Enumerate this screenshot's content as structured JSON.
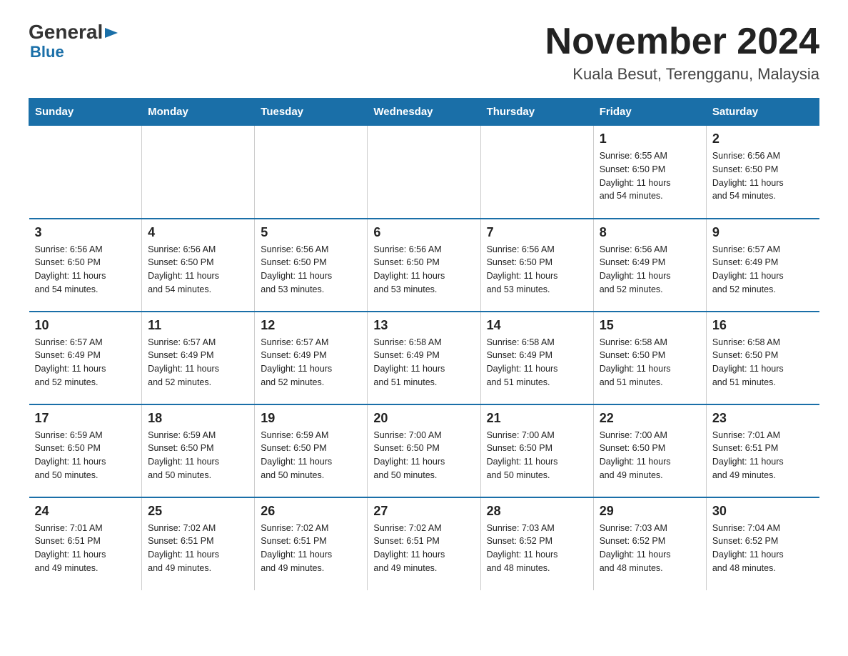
{
  "logo": {
    "general": "General",
    "blue": "Blue"
  },
  "title": {
    "month": "November 2024",
    "location": "Kuala Besut, Terengganu, Malaysia"
  },
  "weekdays": [
    "Sunday",
    "Monday",
    "Tuesday",
    "Wednesday",
    "Thursday",
    "Friday",
    "Saturday"
  ],
  "weeks": [
    [
      {
        "day": "",
        "info": ""
      },
      {
        "day": "",
        "info": ""
      },
      {
        "day": "",
        "info": ""
      },
      {
        "day": "",
        "info": ""
      },
      {
        "day": "",
        "info": ""
      },
      {
        "day": "1",
        "info": "Sunrise: 6:55 AM\nSunset: 6:50 PM\nDaylight: 11 hours\nand 54 minutes."
      },
      {
        "day": "2",
        "info": "Sunrise: 6:56 AM\nSunset: 6:50 PM\nDaylight: 11 hours\nand 54 minutes."
      }
    ],
    [
      {
        "day": "3",
        "info": "Sunrise: 6:56 AM\nSunset: 6:50 PM\nDaylight: 11 hours\nand 54 minutes."
      },
      {
        "day": "4",
        "info": "Sunrise: 6:56 AM\nSunset: 6:50 PM\nDaylight: 11 hours\nand 54 minutes."
      },
      {
        "day": "5",
        "info": "Sunrise: 6:56 AM\nSunset: 6:50 PM\nDaylight: 11 hours\nand 53 minutes."
      },
      {
        "day": "6",
        "info": "Sunrise: 6:56 AM\nSunset: 6:50 PM\nDaylight: 11 hours\nand 53 minutes."
      },
      {
        "day": "7",
        "info": "Sunrise: 6:56 AM\nSunset: 6:50 PM\nDaylight: 11 hours\nand 53 minutes."
      },
      {
        "day": "8",
        "info": "Sunrise: 6:56 AM\nSunset: 6:49 PM\nDaylight: 11 hours\nand 52 minutes."
      },
      {
        "day": "9",
        "info": "Sunrise: 6:57 AM\nSunset: 6:49 PM\nDaylight: 11 hours\nand 52 minutes."
      }
    ],
    [
      {
        "day": "10",
        "info": "Sunrise: 6:57 AM\nSunset: 6:49 PM\nDaylight: 11 hours\nand 52 minutes."
      },
      {
        "day": "11",
        "info": "Sunrise: 6:57 AM\nSunset: 6:49 PM\nDaylight: 11 hours\nand 52 minutes."
      },
      {
        "day": "12",
        "info": "Sunrise: 6:57 AM\nSunset: 6:49 PM\nDaylight: 11 hours\nand 52 minutes."
      },
      {
        "day": "13",
        "info": "Sunrise: 6:58 AM\nSunset: 6:49 PM\nDaylight: 11 hours\nand 51 minutes."
      },
      {
        "day": "14",
        "info": "Sunrise: 6:58 AM\nSunset: 6:49 PM\nDaylight: 11 hours\nand 51 minutes."
      },
      {
        "day": "15",
        "info": "Sunrise: 6:58 AM\nSunset: 6:50 PM\nDaylight: 11 hours\nand 51 minutes."
      },
      {
        "day": "16",
        "info": "Sunrise: 6:58 AM\nSunset: 6:50 PM\nDaylight: 11 hours\nand 51 minutes."
      }
    ],
    [
      {
        "day": "17",
        "info": "Sunrise: 6:59 AM\nSunset: 6:50 PM\nDaylight: 11 hours\nand 50 minutes."
      },
      {
        "day": "18",
        "info": "Sunrise: 6:59 AM\nSunset: 6:50 PM\nDaylight: 11 hours\nand 50 minutes."
      },
      {
        "day": "19",
        "info": "Sunrise: 6:59 AM\nSunset: 6:50 PM\nDaylight: 11 hours\nand 50 minutes."
      },
      {
        "day": "20",
        "info": "Sunrise: 7:00 AM\nSunset: 6:50 PM\nDaylight: 11 hours\nand 50 minutes."
      },
      {
        "day": "21",
        "info": "Sunrise: 7:00 AM\nSunset: 6:50 PM\nDaylight: 11 hours\nand 50 minutes."
      },
      {
        "day": "22",
        "info": "Sunrise: 7:00 AM\nSunset: 6:50 PM\nDaylight: 11 hours\nand 49 minutes."
      },
      {
        "day": "23",
        "info": "Sunrise: 7:01 AM\nSunset: 6:51 PM\nDaylight: 11 hours\nand 49 minutes."
      }
    ],
    [
      {
        "day": "24",
        "info": "Sunrise: 7:01 AM\nSunset: 6:51 PM\nDaylight: 11 hours\nand 49 minutes."
      },
      {
        "day": "25",
        "info": "Sunrise: 7:02 AM\nSunset: 6:51 PM\nDaylight: 11 hours\nand 49 minutes."
      },
      {
        "day": "26",
        "info": "Sunrise: 7:02 AM\nSunset: 6:51 PM\nDaylight: 11 hours\nand 49 minutes."
      },
      {
        "day": "27",
        "info": "Sunrise: 7:02 AM\nSunset: 6:51 PM\nDaylight: 11 hours\nand 49 minutes."
      },
      {
        "day": "28",
        "info": "Sunrise: 7:03 AM\nSunset: 6:52 PM\nDaylight: 11 hours\nand 48 minutes."
      },
      {
        "day": "29",
        "info": "Sunrise: 7:03 AM\nSunset: 6:52 PM\nDaylight: 11 hours\nand 48 minutes."
      },
      {
        "day": "30",
        "info": "Sunrise: 7:04 AM\nSunset: 6:52 PM\nDaylight: 11 hours\nand 48 minutes."
      }
    ]
  ]
}
